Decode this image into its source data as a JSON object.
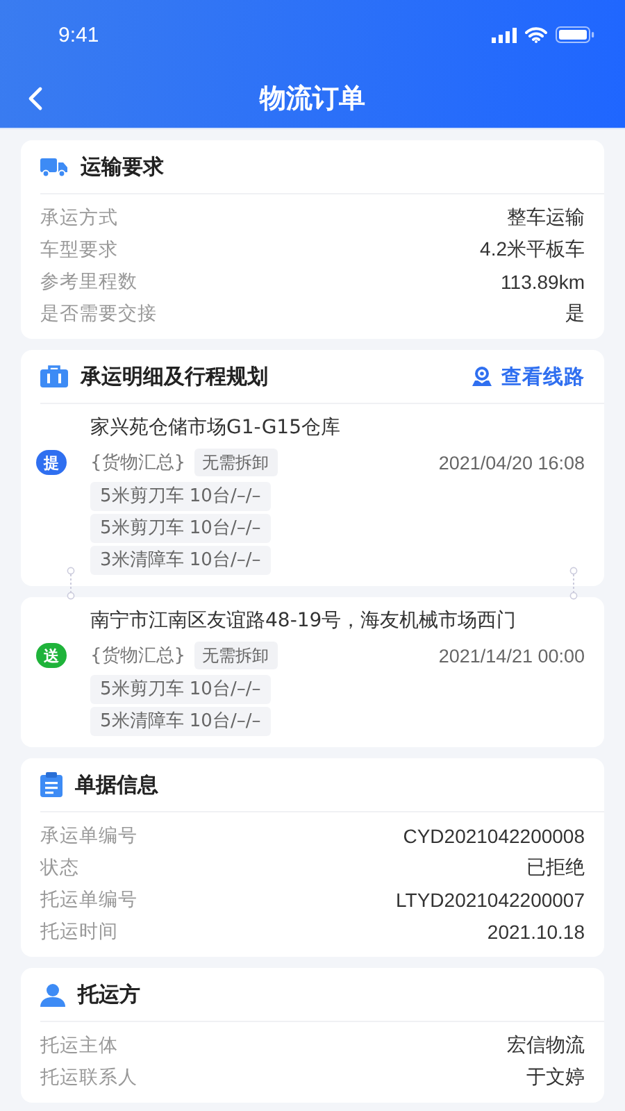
{
  "status_bar": {
    "time": "9:41"
  },
  "nav": {
    "title": "物流订单"
  },
  "transport": {
    "title": "运输要求",
    "rows": [
      {
        "label": "承运方式",
        "value": "整车运输"
      },
      {
        "label": "车型要求",
        "value": "4.2米平板车"
      },
      {
        "label": "参考里程数",
        "value": "113.89km"
      },
      {
        "label": "是否需要交接",
        "value": "是"
      }
    ]
  },
  "route": {
    "title": "承运明细及行程规划",
    "link": "查看线路",
    "stops": [
      {
        "kind": "pickup",
        "badge": "提",
        "address": "家兴苑仓储市场G1-G15仓库",
        "summary": "{货物汇总}",
        "tag": "无需拆卸",
        "time": "2021/04/20 16:08",
        "items": [
          "5米剪刀车 10台/–/–",
          "5米剪刀车 10台/–/–",
          "3米清障车 10台/–/–"
        ]
      },
      {
        "kind": "delivery",
        "badge": "送",
        "address": "南宁市江南区友谊路48-19号，海友机械市场西门",
        "summary": "{货物汇总}",
        "tag": "无需拆卸",
        "time": "2021/14/21 00:00",
        "items": [
          "5米剪刀车 10台/–/–",
          "5米清障车 10台/–/–"
        ]
      }
    ]
  },
  "document": {
    "title": "单据信息",
    "rows": [
      {
        "label": "承运单编号",
        "value": "CYD2021042200008"
      },
      {
        "label": "状态",
        "value": "已拒绝"
      },
      {
        "label": "托运单编号",
        "value": "LTYD2021042200007"
      },
      {
        "label": "托运时间",
        "value": "2021.10.18"
      }
    ]
  },
  "shipper": {
    "title": "托运方",
    "rows": [
      {
        "label": "托运主体",
        "value": "宏信物流"
      },
      {
        "label": "托运联系人",
        "value": "于文婷"
      }
    ]
  }
}
